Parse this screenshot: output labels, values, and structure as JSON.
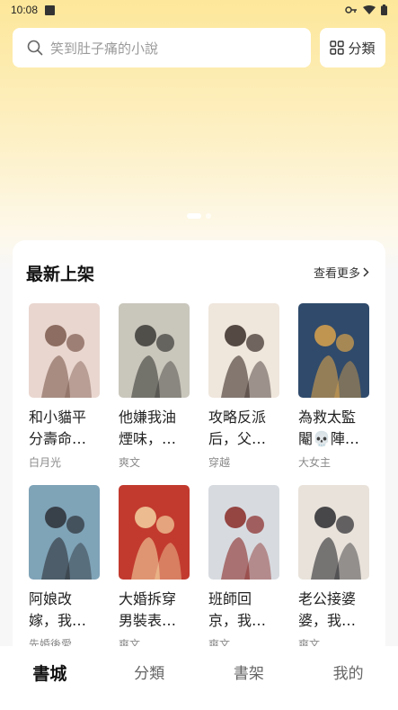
{
  "status": {
    "time": "10:08"
  },
  "search": {
    "placeholder": "笑到肚子痛的小說"
  },
  "category_button": {
    "label": "分類"
  },
  "banner": {
    "dots": 2,
    "active": 0
  },
  "section": {
    "title": "最新上架",
    "more": "查看更多"
  },
  "books": [
    {
      "title": "和小貓平分壽命…",
      "tag": "白月光",
      "cover_bg": "#e9d6cf",
      "accent": "#7d5a4e"
    },
    {
      "title": "他嫌我油煙味，…",
      "tag": "爽文",
      "cover_bg": "#c9c6bc",
      "accent": "#3b3a36"
    },
    {
      "title": "攻略反派后，父…",
      "tag": "穿越",
      "cover_bg": "#efe6dc",
      "accent": "#3a2d28"
    },
    {
      "title": "為救太監閹💀陣…",
      "tag": "大女主",
      "cover_bg": "#2f4a6b",
      "accent": "#d9a24b"
    },
    {
      "title": "阿娘改嫁，我…",
      "tag": "先婚後愛",
      "cover_bg": "#7fa3b7",
      "accent": "#2b2f36"
    },
    {
      "title": "大婚拆穿男裝表…",
      "tag": "爽文",
      "cover_bg": "#c23a2e",
      "accent": "#f3d2a0"
    },
    {
      "title": "班師回京，我…",
      "tag": "爽文",
      "cover_bg": "#d7dbe0",
      "accent": "#8a2a26"
    },
    {
      "title": "老公接婆婆，我…",
      "tag": "爽文",
      "cover_bg": "#e8e2da",
      "accent": "#2a2a2e"
    }
  ],
  "tabs": [
    {
      "label": "書城",
      "active": true
    },
    {
      "label": "分類",
      "active": false
    },
    {
      "label": "書架",
      "active": false
    },
    {
      "label": "我的",
      "active": false
    }
  ]
}
